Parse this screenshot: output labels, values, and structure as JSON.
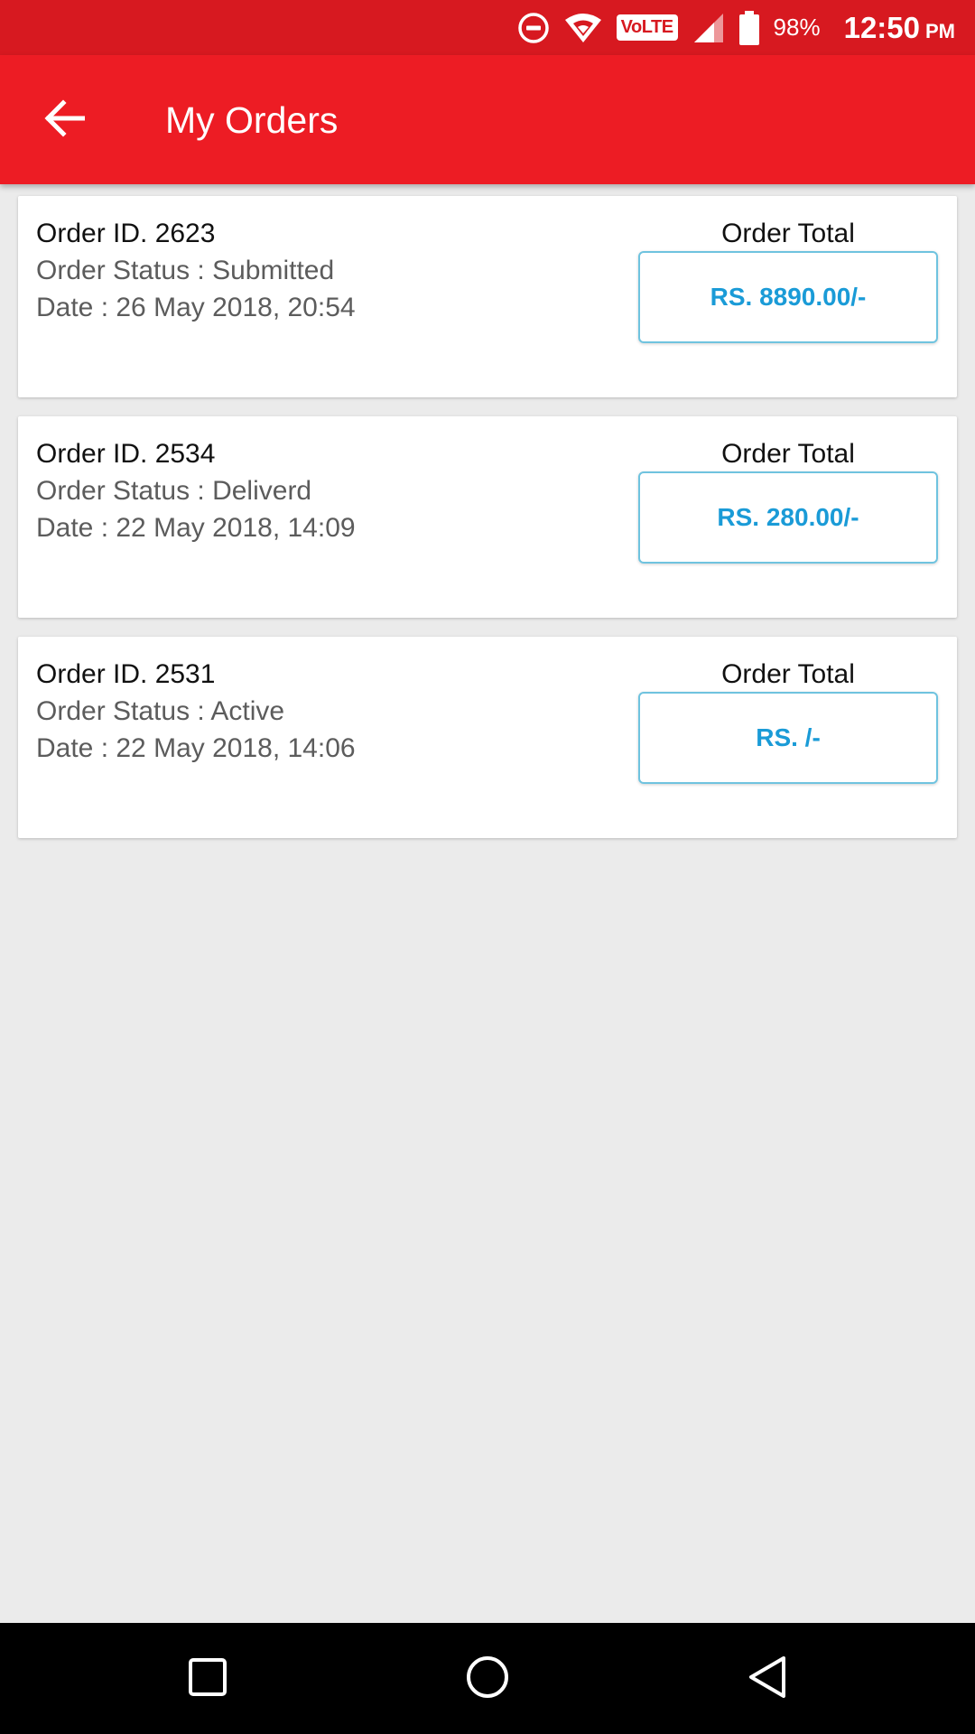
{
  "status_bar": {
    "battery_percent": "98%",
    "time": "12:50",
    "ampm": "PM",
    "network_badge": "VoLTE",
    "icons": [
      "do-not-disturb-icon",
      "wifi-icon",
      "volte-icon",
      "cell-signal-icon",
      "battery-icon"
    ]
  },
  "app_bar": {
    "title": "My Orders",
    "back_icon": "arrow-back-icon"
  },
  "orders": [
    {
      "id": "Order ID. 2623",
      "status": "Order Status : Submitted",
      "date": "Date : 26 May 2018, 20:54",
      "total_label": "Order Total",
      "total": "RS. 8890.00/-"
    },
    {
      "id": "Order ID. 2534",
      "status": "Order Status : Deliverd",
      "date": "Date : 22 May 2018, 14:09",
      "total_label": "Order Total",
      "total": "RS. 280.00/-"
    },
    {
      "id": "Order ID. 2531",
      "status": "Order Status : Active",
      "date": "Date : 22 May 2018, 14:06",
      "total_label": "Order Total",
      "total": "RS. /-"
    }
  ],
  "colors": {
    "status_bar": "#d71920",
    "app_bar": "#ed1c24",
    "total_text": "#1a9bd7",
    "total_border": "#6fc3df",
    "background": "#ebebeb"
  },
  "nav_bar": {
    "icons": [
      "recents-icon",
      "home-icon",
      "back-icon"
    ]
  }
}
